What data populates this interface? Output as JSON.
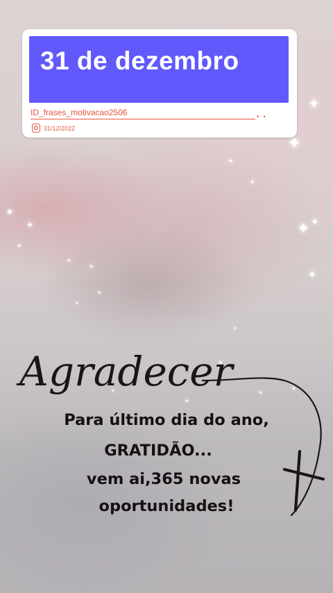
{
  "sticker": {
    "title": "31 de dezembro",
    "id_text": "ID_frases_motivacao2506",
    "dots": "• •",
    "date_icon_letter": "D",
    "date": "31/12/2022",
    "banner_color": "#6159fb",
    "accent_color": "#e5533a"
  },
  "artwork": {
    "script_word": "Agradecer",
    "icons": [
      "cross-icon",
      "sparkle-icon"
    ]
  },
  "caption": {
    "line1": "Para último dia do ano,",
    "line2": "GRATIDÃO...",
    "line3": "vem ai,365 novas",
    "line4": "oportunidades!"
  }
}
